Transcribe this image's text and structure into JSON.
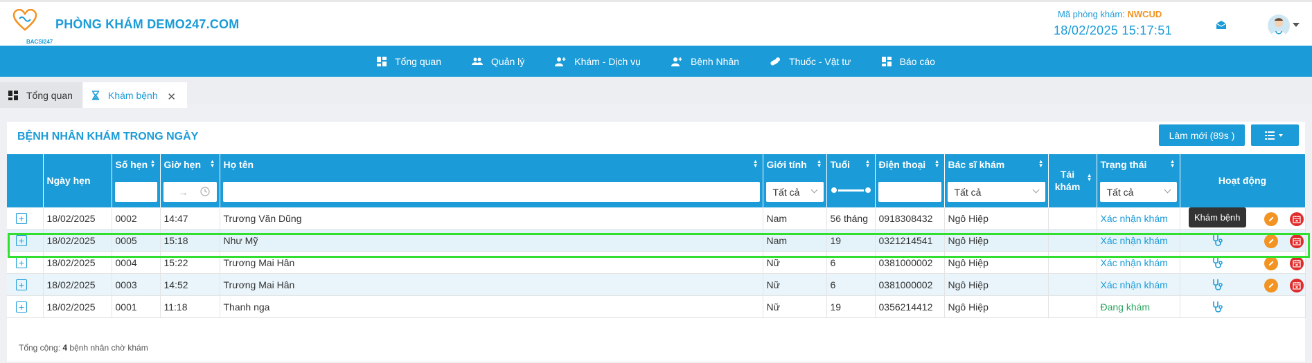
{
  "header": {
    "clinic_name": "PHÒNG KHÁM DEMO247.COM",
    "logo_text": "BACSI247",
    "code_label": "Mã phòng khám:",
    "code_value": "NWCUD",
    "datetime": "18/02/2025 15:17:51"
  },
  "nav": [
    {
      "label": "Tổng quan",
      "icon": "dashboard-icon"
    },
    {
      "label": "Quản lý",
      "icon": "users-icon"
    },
    {
      "label": "Khám - Dịch vụ",
      "icon": "user-plus-icon"
    },
    {
      "label": "Bệnh Nhân",
      "icon": "user-plus-icon"
    },
    {
      "label": "Thuốc - Vật tư",
      "icon": "pill-icon"
    },
    {
      "label": "Báo cáo",
      "icon": "report-icon"
    }
  ],
  "tabs": [
    {
      "label": "Tổng quan",
      "icon": "dashboard-icon"
    },
    {
      "label": "Khám bệnh",
      "icon": "hourglass-icon",
      "active": true
    }
  ],
  "panel": {
    "title": "BỆNH NHÂN KHÁM TRONG NGÀY",
    "refresh_label": "Làm mới (89s )"
  },
  "columns": {
    "date": "Ngày hẹn",
    "number": "Số hẹn",
    "time": "Giờ hẹn",
    "name": "Họ tên",
    "gender": "Giới tính",
    "age": "Tuổi",
    "phone": "Điện thoại",
    "doctor": "Bác sĩ khám",
    "revisit": "Tái khám",
    "status": "Trạng thái",
    "actions": "Hoạt động"
  },
  "filters": {
    "gender": "Tất cả",
    "doctor": "Tất cả",
    "status": "Tất cả",
    "time_arrow": "→"
  },
  "rows": [
    {
      "date": "18/02/2025",
      "number": "0002",
      "time": "14:47",
      "name": "Trương Văn Dũng",
      "gender": "Nam",
      "age": "56 tháng",
      "phone": "0918308432",
      "doctor": "Ngô Hiệp",
      "status": "Xác nhận khám"
    },
    {
      "date": "18/02/2025",
      "number": "0005",
      "time": "15:18",
      "name": "Như Mỹ",
      "gender": "Nam",
      "age": "19",
      "phone": "0321214541",
      "doctor": "Ngô Hiệp",
      "status": "Xác nhận khám"
    },
    {
      "date": "18/02/2025",
      "number": "0004",
      "time": "15:22",
      "name": "Trương Mai Hân",
      "gender": "Nữ",
      "age": "6",
      "phone": "0381000002",
      "doctor": "Ngô Hiệp",
      "status": "Xác nhận khám"
    },
    {
      "date": "18/02/2025",
      "number": "0003",
      "time": "14:52",
      "name": "Trương Mai Hân",
      "gender": "Nữ",
      "age": "6",
      "phone": "0381000002",
      "doctor": "Ngô Hiệp",
      "status": "Xác nhận khám"
    },
    {
      "date": "18/02/2025",
      "number": "0001",
      "time": "11:18",
      "name": "Thanh nga",
      "gender": "Nữ",
      "age": "19",
      "phone": "0356214412",
      "doctor": "Ngô Hiệp",
      "status": "Đang khám"
    }
  ],
  "tooltip": "Khám bệnh",
  "footer": {
    "prefix": "Tổng cộng:",
    "count": "4",
    "suffix": "bệnh nhân chờ khám"
  },
  "colors": {
    "primary": "#1b9bd7",
    "orange": "#f29322",
    "red": "#e02b2b",
    "green_status": "#2aa55f",
    "highlight": "#31e02f"
  }
}
